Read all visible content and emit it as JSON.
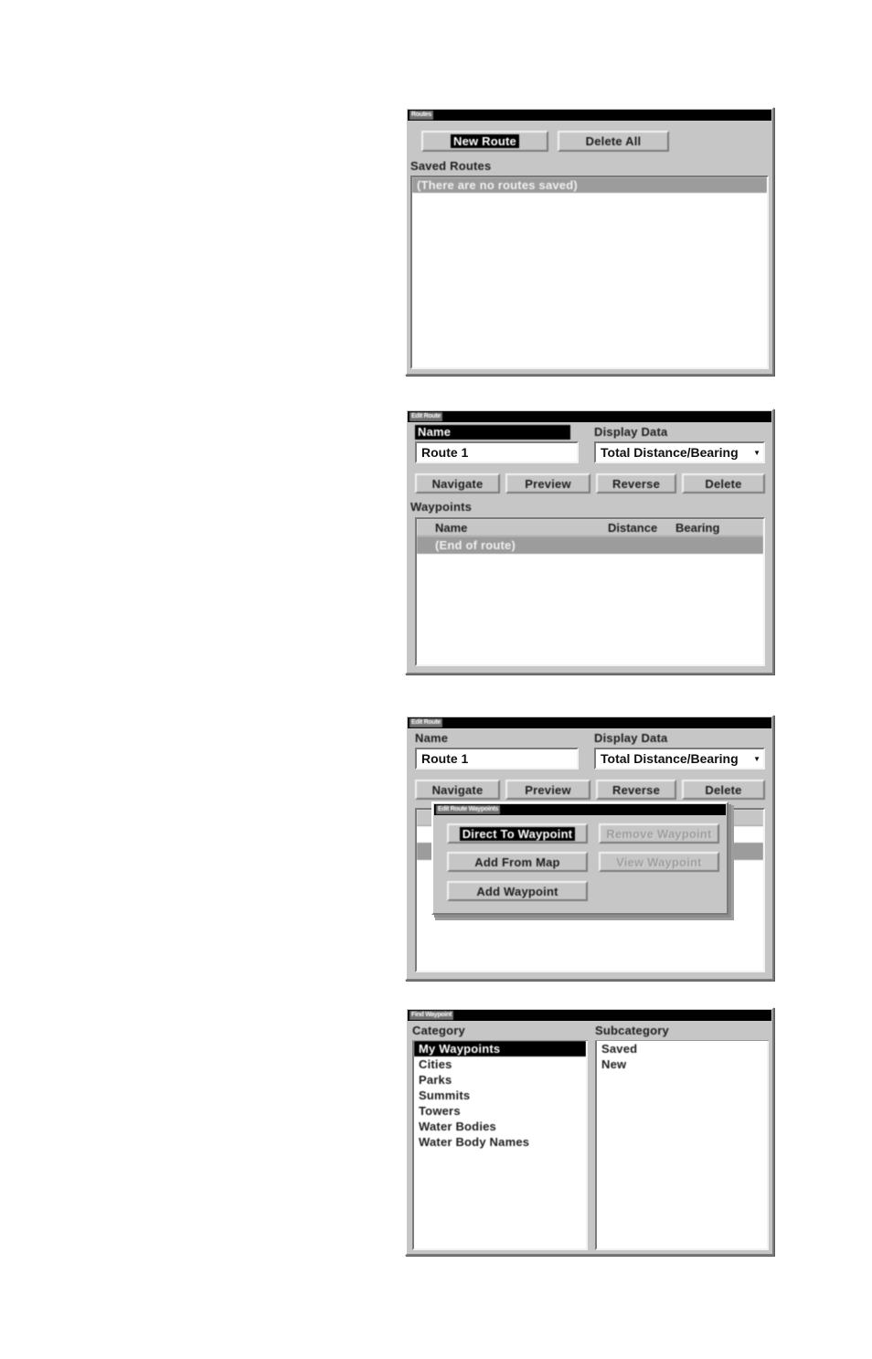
{
  "panels": {
    "routes": {
      "title": "Routes",
      "new_route_label": "New Route",
      "delete_all_label": "Delete All",
      "saved_routes_label": "Saved Routes",
      "list_rows": [
        "(There are no routes saved)"
      ]
    },
    "edit_route": {
      "title": "Edit Route",
      "name_label": "Name",
      "name_value": "Route 1",
      "display_data_label": "Display Data",
      "display_data_value": "Total Distance/Bearing",
      "dropdown_caret": "▼",
      "buttons": [
        "Navigate",
        "Preview",
        "Reverse",
        "Delete"
      ],
      "waypoints_label": "Waypoints",
      "columns": [
        "Name",
        "Distance",
        "Bearing"
      ],
      "list_rows": [
        "(End of route)"
      ]
    },
    "edit_route_waypoints": {
      "title": "Edit Route",
      "name_label": "Name",
      "name_value": "Route 1",
      "display_data_label": "Display Data",
      "display_data_value": "Total Distance/Bearing",
      "dropdown_caret": "▼",
      "buttons": [
        "Navigate",
        "Preview",
        "Reverse",
        "Delete"
      ],
      "dialog": {
        "title": "Edit Route Waypoints",
        "direct_to_waypoint_label": "Direct To Waypoint",
        "remove_waypoint_label": "Remove Waypoint",
        "add_from_map_label": "Add From Map",
        "view_waypoint_label": "View Waypoint",
        "add_waypoint_label": "Add Waypoint"
      }
    },
    "find_waypoint": {
      "title": "Find Waypoint",
      "category_label": "Category",
      "subcategory_label": "Subcategory",
      "categories": [
        "My Waypoints",
        "Cities",
        "Parks",
        "Summits",
        "Towers",
        "Water Bodies",
        "Water Body Names"
      ],
      "selected_category": "My Waypoints",
      "subcategories": [
        "Saved",
        "New"
      ]
    }
  }
}
